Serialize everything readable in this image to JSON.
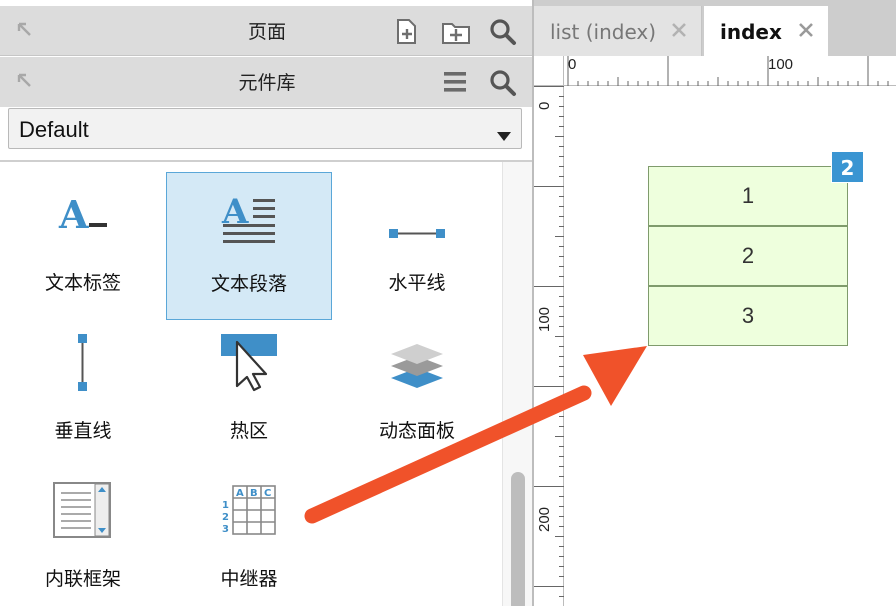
{
  "pages_panel": {
    "title": "页面"
  },
  "library_panel": {
    "title": "元件库",
    "selected_library": "Default",
    "widgets": [
      {
        "label": "文本标签",
        "icon": "text-label-icon"
      },
      {
        "label": "文本段落",
        "icon": "text-paragraph-icon",
        "selected": true
      },
      {
        "label": "水平线",
        "icon": "horizontal-line-icon"
      },
      {
        "label": "垂直线",
        "icon": "vertical-line-icon"
      },
      {
        "label": "热区",
        "icon": "hotspot-icon"
      },
      {
        "label": "动态面板",
        "icon": "dynamic-panel-icon"
      },
      {
        "label": "内联框架",
        "icon": "inline-frame-icon"
      },
      {
        "label": "中继器",
        "icon": "repeater-icon"
      }
    ]
  },
  "tabs": [
    {
      "label": "list (index)",
      "active": false
    },
    {
      "label": "index",
      "active": true
    }
  ],
  "rulers": {
    "horizontal_labels": [
      "0",
      "100"
    ],
    "vertical_labels": [
      "0",
      "100",
      "200"
    ]
  },
  "canvas": {
    "repeater_rows": [
      "1",
      "2",
      "3"
    ],
    "badge": "2"
  },
  "colors": {
    "accent_blue": "#3a95d2",
    "repeater_fill": "#eeffdd",
    "arrow": "#f0522a",
    "selection_fill": "#d4e9f6"
  },
  "icons": {
    "pages_add_page": "add-page-icon",
    "pages_add_folder": "add-folder-icon",
    "search": "search-icon",
    "menu": "hamburger-menu-icon",
    "collapse": "collapse-arrow-icon",
    "close": "close-icon",
    "dropdown": "caret-down-icon"
  }
}
